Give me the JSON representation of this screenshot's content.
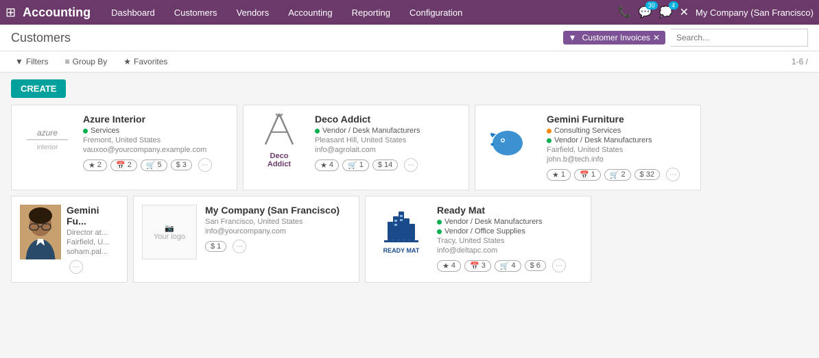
{
  "app": {
    "title": "Accounting",
    "nav": [
      "Dashboard",
      "Customers",
      "Vendors",
      "Accounting",
      "Reporting",
      "Configuration"
    ],
    "notifications": {
      "phone_badge": "",
      "msg_badge": "30",
      "chat_badge": "4"
    },
    "company": "My Company (San Francisco)"
  },
  "header": {
    "page_title": "Customers",
    "filter_tag": "Customer Invoices",
    "search_placeholder": "Search..."
  },
  "toolbar": {
    "filters_label": "Filters",
    "groupby_label": "Group By",
    "favorites_label": "Favorites",
    "pagination": "1-6 /"
  },
  "action_bar": {
    "create_label": "CREATE"
  },
  "customers": [
    {
      "name": "Azure Interior",
      "tags": [
        "Services"
      ],
      "tag_colors": [
        "green"
      ],
      "address": "Fremont, United States",
      "email": "vauxoo@yourcompany.example.com",
      "badges": [
        {
          "icon": "★",
          "count": "2"
        },
        {
          "icon": "📅",
          "count": "2"
        },
        {
          "icon": "🛒",
          "count": "5"
        },
        {
          "icon": "$",
          "count": "3"
        }
      ],
      "logo_text": "azure\ninterior",
      "logo_type": "text"
    },
    {
      "name": "Deco Addict",
      "tags": [
        "Vendor / Desk Manufacturers"
      ],
      "tag_colors": [
        "green"
      ],
      "address": "Pleasant Hill, United States",
      "email": "info@agrolait.com",
      "badges": [
        {
          "icon": "★",
          "count": "4"
        },
        {
          "icon": "🛒",
          "count": "1"
        },
        {
          "icon": "$",
          "count": "14"
        }
      ],
      "logo_text": "Deco Addict",
      "logo_type": "svg_deco"
    },
    {
      "name": "Gemini Furniture",
      "tags": [
        "Consulting Services",
        "Vendor / Desk Manufacturers"
      ],
      "tag_colors": [
        "orange",
        "green"
      ],
      "address": "Fairfield, United States",
      "email": "john.b@tech.info",
      "badges": [
        {
          "icon": "★",
          "count": "1"
        },
        {
          "icon": "📅",
          "count": "1"
        },
        {
          "icon": "🛒",
          "count": "2"
        },
        {
          "icon": "$",
          "count": "32"
        }
      ],
      "logo_text": "Gemini Furniture",
      "logo_type": "svg_gemini"
    },
    {
      "name": "My Company (San Francisco)",
      "tags": [],
      "tag_colors": [],
      "address": "San Francisco, United States",
      "email": "info@yourcompany.com",
      "badges": [
        {
          "icon": "$",
          "count": "1"
        }
      ],
      "logo_text": "Your logo",
      "logo_type": "placeholder"
    },
    {
      "name": "Ready Mat",
      "tags": [
        "Vendor / Desk Manufacturers",
        "Vendor / Office Supplies"
      ],
      "tag_colors": [
        "green",
        "green"
      ],
      "address": "Tracy, United States",
      "email": "info@deltapc.com",
      "badges": [
        {
          "icon": "★",
          "count": "4"
        },
        {
          "icon": "📅",
          "count": "3"
        },
        {
          "icon": "🛒",
          "count": "4"
        },
        {
          "icon": "$",
          "count": "6"
        }
      ],
      "logo_text": "Ready Mat",
      "logo_type": "svg_ready"
    },
    {
      "name": "Gemini Fu...",
      "tags": [],
      "tag_colors": [],
      "address": "Director at...",
      "email": "Fairfield, U...",
      "secondary_email": "soham.pal...",
      "logo_type": "photo",
      "partial": true
    }
  ]
}
